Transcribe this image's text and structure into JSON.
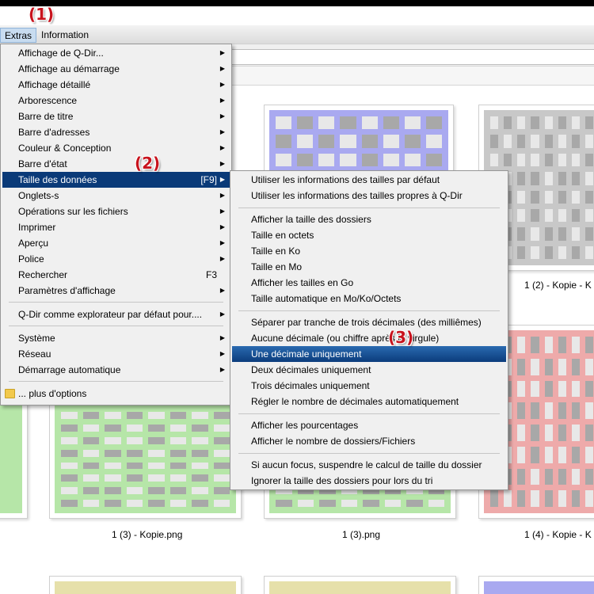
{
  "menubar": {
    "extras": "Extras",
    "information": "Information"
  },
  "steps": {
    "one": "(1)",
    "two": "(2)",
    "three": "(3)"
  },
  "extras_menu": [
    {
      "label": "Affichage de Q-Dir...",
      "arrow": "▶"
    },
    {
      "label": "Affichage au démarrage",
      "arrow": "▶"
    },
    {
      "label": "Affichage détaillé",
      "arrow": "▶"
    },
    {
      "label": "Arborescence",
      "arrow": "▶"
    },
    {
      "label": "Barre de titre",
      "arrow": "▶"
    },
    {
      "label": "Barre d'adresses",
      "arrow": "▶"
    },
    {
      "label": "Couleur & Conception",
      "arrow": "▶"
    },
    {
      "label": "Barre d'état",
      "arrow": "▶"
    },
    {
      "label": "Taille des données",
      "shortcut": "[F9]",
      "arrow": "▶",
      "highlighted": true
    },
    {
      "label": "Onglets-s",
      "arrow": "▶"
    },
    {
      "label": "Opérations sur les fichiers",
      "arrow": "▶"
    },
    {
      "label": "Imprimer",
      "arrow": "▶"
    },
    {
      "label": "Aperçu",
      "arrow": "▶"
    },
    {
      "label": "Police",
      "arrow": "▶"
    },
    {
      "label": "Rechercher",
      "shortcut": "F3"
    },
    {
      "label": "Paramètres d'affichage",
      "arrow": "▶"
    },
    {
      "label": "Q-Dir comme explorateur par défaut pour....",
      "arrow": "▶"
    },
    {
      "label": "Système",
      "arrow": "▶"
    },
    {
      "label": "Réseau",
      "arrow": "▶"
    },
    {
      "label": "Démarrage automatique",
      "arrow": "▶"
    },
    {
      "label": "... plus d'options"
    }
  ],
  "size_menu": [
    "Utiliser les informations des tailles par défaut",
    "Utiliser les informations des tailles propres à Q-Dir",
    "Afficher la taille des dossiers",
    "Taille en octets",
    "Taille en Ko",
    "Taille en Mo",
    "Afficher les tailles en Go",
    "Taille automatique en Mo/Ko/Octets",
    "Séparer par tranche de trois décimales (des milliêmes)",
    "Aucune décimale (ou chiffre après la virgule)",
    "Une décimale uniquement",
    "Deux décimales uniquement",
    "Trois décimales uniquement",
    "Régler le nombre de décimales automatiquement",
    "Afficher les pourcentages",
    "Afficher le nombre de dossiers/Fichiers",
    "Si aucun focus, suspendre le calcul de taille du dossier",
    "Ignorer la taille des dossiers pour lors du tri"
  ],
  "thumbnails": {
    "captions": [
      "1 (2) - Kopie - K",
      "1 (3) - Kopie.png",
      "1 (3).png",
      "1 (4) - Kopie - K"
    ],
    "colors": {
      "blue": "#a9a9f0",
      "gray": "#c8c8c8",
      "red": "#eeaaaa",
      "green": "#b6e6a8",
      "yellow": "#e6e0aa"
    }
  },
  "colors": {
    "highlight": "#0a3a78",
    "menu_bg": "#f0f0f0",
    "step_badge": "#c8141e"
  }
}
